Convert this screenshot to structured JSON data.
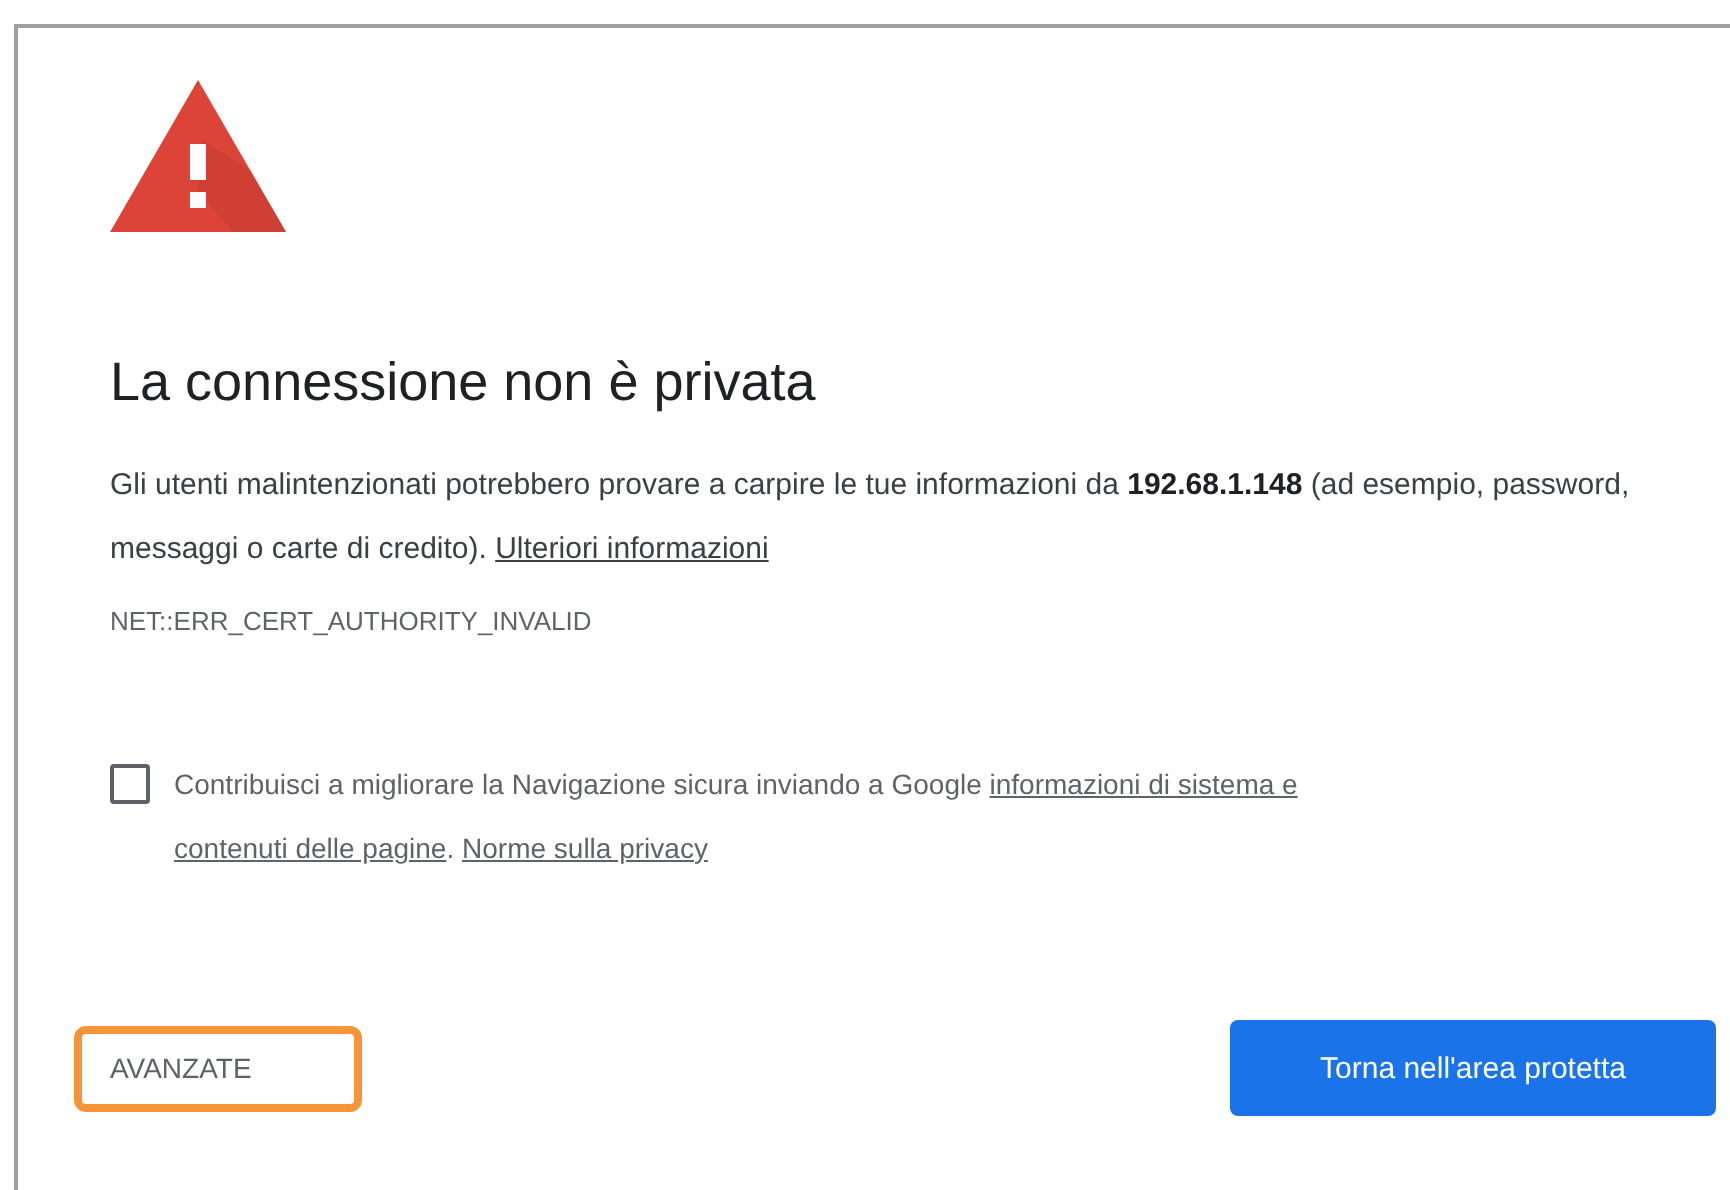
{
  "heading": "La connessione non è privata",
  "message": "Gli utenti malintenzionati potrebbero provare a carpire le tue informazioni da **192.68.1.148** (ad esempio, password, messaggi o carte di credito).",
  "message_link": "Ulteriori informazioni",
  "error_code": "NET::ERR_CERT_AUTHORITY_INVALID",
  "report": {
    "checked": false,
    "text": "Contribuisci a migliorare la Navigazione sicura inviando a Google",
    "link_lines": [
      "informazioni di sistema e",
      "contenuti delle pagine"
    ],
    "separator": ".",
    "privacy_link": "Norme sulla privacy"
  },
  "buttons": {
    "advanced": "AVANZATE",
    "back": "Torna nell'area protetta"
  }
}
